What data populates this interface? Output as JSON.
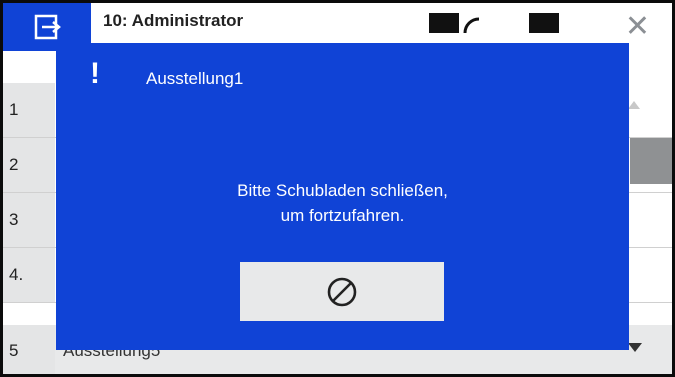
{
  "header": {
    "title": "10: Administrator"
  },
  "list": {
    "rows": [
      {
        "num": "1",
        "label": ""
      },
      {
        "num": "2",
        "label": ""
      },
      {
        "num": "3",
        "label": ""
      },
      {
        "num": "4.",
        "label": ""
      },
      {
        "num": "5",
        "label": "Ausstellung5"
      }
    ]
  },
  "modal": {
    "title": "Ausstellung1",
    "message_line1": "Bitte Schubladen schließen,",
    "message_line2": "um fortzufahren.",
    "alert_icon": "exclamation-icon",
    "button_icon": "prohibited-icon"
  },
  "colors": {
    "accent": "#1043d6",
    "button_bg": "#e8e9ea"
  }
}
